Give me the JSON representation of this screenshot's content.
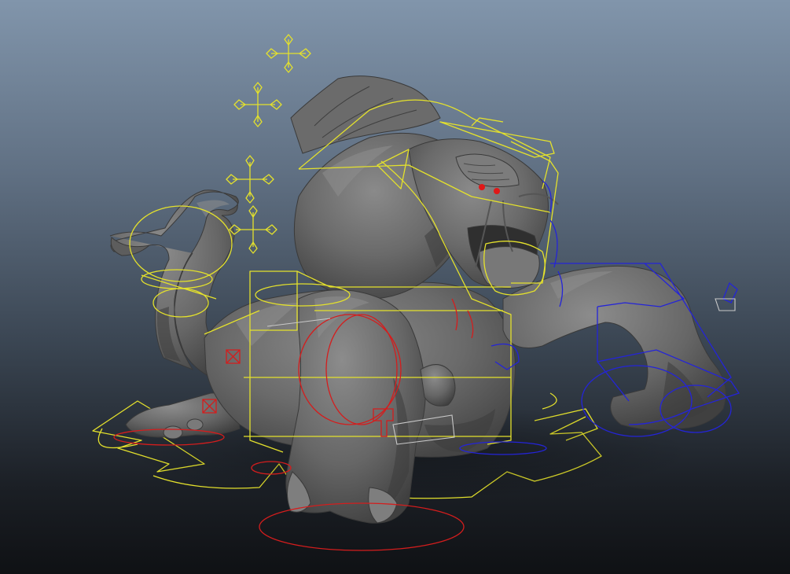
{
  "viewport": {
    "background_top": "#8195ab",
    "background_bottom": "#0f1114"
  },
  "model": {
    "mesh_color": "#6b6b6b",
    "eye_color": "#e01818"
  },
  "rig_controls": {
    "spine_color": "#e4e12c",
    "left_side_color": "#d41d1d",
    "right_side_color": "#2424d8",
    "selected_color": "#c9c9c9",
    "icons": [
      "ik-cross-control-icon",
      "fk-circle-control-icon",
      "box-control-icon",
      "root-arrow-control-icon"
    ]
  }
}
